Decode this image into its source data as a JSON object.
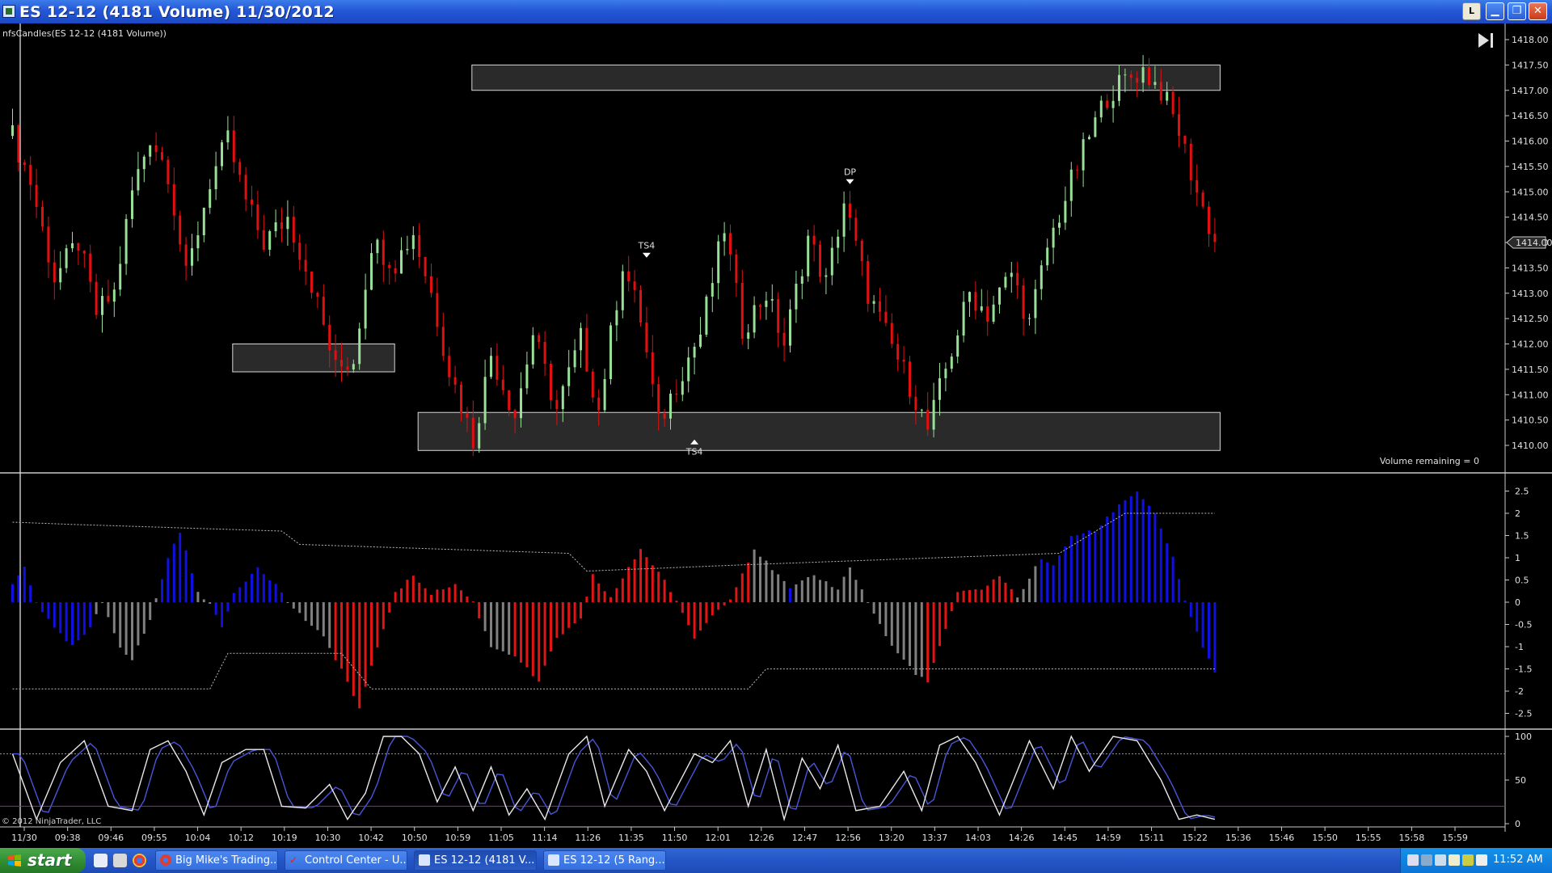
{
  "window": {
    "title": "ES 12-12 (4181 Volume)  11/30/2012",
    "btn_l": "L",
    "btn_min": "▁",
    "btn_max": "❐",
    "btn_close": "✕"
  },
  "chart_text": {
    "indicator_label": "nfsCandles(ES 12-12 (4181 Volume))",
    "volume_remaining": "Volume remaining = 0",
    "copyright": "© 2012 NinjaTrader, LLC",
    "price_marker": "1414.00",
    "markers": [
      "TS4",
      "DP",
      "TS4"
    ]
  },
  "colors": {
    "bull": "#98e098",
    "bear": "#e01010",
    "hist_blue": "#1010e0",
    "hist_red": "#e01515",
    "hist_gray": "#808080",
    "stoch_k": "#e8e8e8",
    "stoch_d": "#4a55d8",
    "axis_text": "#e0e0e0"
  },
  "chart_data": [
    {
      "type": "candlestick",
      "ylim": [
        1410.0,
        1418.0
      ],
      "y_ticks": [
        "1418.00",
        "1417.50",
        "1417.00",
        "1416.50",
        "1416.00",
        "1415.50",
        "1415.00",
        "1414.50",
        "1414.00",
        "1413.50",
        "1413.00",
        "1412.50",
        "1412.00",
        "1411.50",
        "1411.00",
        "1410.50",
        "1410.00"
      ],
      "x_ticks": [
        "11/30",
        "09:38",
        "09:46",
        "09:55",
        "10:04",
        "10:12",
        "10:19",
        "10:30",
        "10:42",
        "10:50",
        "10:59",
        "11:05",
        "11:14",
        "11:26",
        "11:35",
        "11:50",
        "12:01",
        "12:26",
        "12:47",
        "12:56",
        "13:20",
        "13:37",
        "14:03",
        "14:26",
        "14:45",
        "14:59",
        "15:11",
        "15:22",
        "15:36",
        "15:46",
        "15:50",
        "15:55",
        "15:58",
        "15:59"
      ],
      "close_path": [
        [
          0,
          1416.1
        ],
        [
          3,
          1415.2
        ],
        [
          7,
          1413.3
        ],
        [
          11,
          1414.0
        ],
        [
          14,
          1412.6
        ],
        [
          17,
          1413.0
        ],
        [
          20,
          1415.0
        ],
        [
          23,
          1416.1
        ],
        [
          26,
          1415.4
        ],
        [
          29,
          1413.3
        ],
        [
          33,
          1415.2
        ],
        [
          36,
          1416.0
        ],
        [
          39,
          1414.8
        ],
        [
          42,
          1414.0
        ],
        [
          46,
          1414.5
        ],
        [
          50,
          1413.2
        ],
        [
          54,
          1411.5
        ],
        [
          57,
          1411.7
        ],
        [
          60,
          1414.0
        ],
        [
          64,
          1413.6
        ],
        [
          67,
          1414.2
        ],
        [
          70,
          1413.0
        ],
        [
          73,
          1411.5
        ],
        [
          77,
          1410.1
        ],
        [
          80,
          1411.8
        ],
        [
          84,
          1410.6
        ],
        [
          87,
          1412.2
        ],
        [
          91,
          1410.7
        ],
        [
          95,
          1412.1
        ],
        [
          98,
          1410.7
        ],
        [
          102,
          1413.6
        ],
        [
          105,
          1412.5
        ],
        [
          108,
          1410.4
        ],
        [
          112,
          1411.5
        ],
        [
          115,
          1412.2
        ],
        [
          119,
          1414.3
        ],
        [
          122,
          1412.3
        ],
        [
          126,
          1413.0
        ],
        [
          129,
          1412.0
        ],
        [
          133,
          1414.1
        ],
        [
          136,
          1413.2
        ],
        [
          139,
          1414.8
        ],
        [
          143,
          1413.0
        ],
        [
          146,
          1412.2
        ],
        [
          150,
          1411.2
        ],
        [
          153,
          1410.3
        ],
        [
          156,
          1411.5
        ],
        [
          160,
          1413.0
        ],
        [
          163,
          1412.6
        ],
        [
          167,
          1413.4
        ],
        [
          170,
          1412.4
        ],
        [
          173,
          1413.9
        ],
        [
          177,
          1415.2
        ],
        [
          180,
          1416.1
        ],
        [
          183,
          1416.9
        ],
        [
          186,
          1417.2
        ],
        [
          189,
          1417.4
        ],
        [
          192,
          1417.0
        ],
        [
          195,
          1416.2
        ],
        [
          198,
          1415.0
        ],
        [
          201,
          1414.0
        ]
      ],
      "n_bars": 202,
      "zones": [
        {
          "x0": 77,
          "x1": 201,
          "y0": 1417.0,
          "y1": 1417.5
        },
        {
          "x0": 37,
          "x1": 63,
          "y0": 1411.45,
          "y1": 1412.0
        },
        {
          "x0": 68,
          "x1": 201,
          "y0": 1409.9,
          "y1": 1410.65
        }
      ],
      "marker_positions": [
        {
          "label": "TS4",
          "x": 106,
          "price": 1413.75,
          "dir": "down"
        },
        {
          "label": "DP",
          "x": 140,
          "price": 1415.2,
          "dir": "down"
        },
        {
          "label": "TS4",
          "x": 114,
          "price": 1410.1,
          "dir": "up"
        }
      ]
    },
    {
      "type": "histogram",
      "ylim": [
        -2.5,
        2.5
      ],
      "y_ticks": [
        "2.5",
        "2",
        "1.5",
        "1",
        "0.5",
        "0",
        "-0.5",
        "-1",
        "-1.5",
        "-2",
        "-2.5"
      ],
      "keypoints": [
        [
          0,
          0.4
        ],
        [
          2,
          0.8
        ],
        [
          4,
          0.0
        ],
        [
          7,
          -0.6
        ],
        [
          10,
          -1.0
        ],
        [
          13,
          -0.6
        ],
        [
          15,
          0.0
        ],
        [
          18,
          -1.0
        ],
        [
          20,
          -1.3
        ],
        [
          23,
          -0.4
        ],
        [
          26,
          1.0
        ],
        [
          28,
          1.6
        ],
        [
          31,
          0.2
        ],
        [
          33,
          0.0
        ],
        [
          35,
          -0.6
        ],
        [
          37,
          0.2
        ],
        [
          41,
          0.8
        ],
        [
          44,
          0.4
        ],
        [
          46,
          0.0
        ],
        [
          52,
          -0.8
        ],
        [
          55,
          -1.5
        ],
        [
          58,
          -2.4
        ],
        [
          61,
          -1.0
        ],
        [
          64,
          0.2
        ],
        [
          67,
          0.6
        ],
        [
          70,
          0.2
        ],
        [
          74,
          0.4
        ],
        [
          77,
          0.0
        ],
        [
          80,
          -1.0
        ],
        [
          84,
          -1.2
        ],
        [
          88,
          -1.8
        ],
        [
          91,
          -0.8
        ],
        [
          95,
          -0.4
        ],
        [
          97,
          0.6
        ],
        [
          100,
          0.1
        ],
        [
          105,
          1.2
        ],
        [
          109,
          0.5
        ],
        [
          111,
          0.0
        ],
        [
          114,
          -0.8
        ],
        [
          117,
          -0.3
        ],
        [
          120,
          0.1
        ],
        [
          124,
          1.2
        ],
        [
          126,
          0.9
        ],
        [
          130,
          0.3
        ],
        [
          134,
          0.6
        ],
        [
          138,
          0.3
        ],
        [
          140,
          0.8
        ],
        [
          143,
          0.0
        ],
        [
          147,
          -1.0
        ],
        [
          151,
          -1.6
        ],
        [
          153,
          -1.8
        ],
        [
          156,
          -0.6
        ],
        [
          158,
          0.2
        ],
        [
          162,
          0.3
        ],
        [
          165,
          0.6
        ],
        [
          168,
          0.1
        ],
        [
          172,
          1.0
        ],
        [
          174,
          0.8
        ],
        [
          177,
          1.5
        ],
        [
          181,
          1.6
        ],
        [
          185,
          2.2
        ],
        [
          188,
          2.5
        ],
        [
          191,
          2.0
        ],
        [
          194,
          1.0
        ],
        [
          196,
          0.0
        ],
        [
          199,
          -1.0
        ],
        [
          201,
          -1.6
        ]
      ],
      "colors_by_range": [
        [
          0,
          5,
          "blue"
        ],
        [
          5,
          14,
          "blue"
        ],
        [
          14,
          21,
          "gray"
        ],
        [
          21,
          25,
          "gray"
        ],
        [
          25,
          31,
          "blue"
        ],
        [
          31,
          34,
          "gray"
        ],
        [
          34,
          36,
          "blue"
        ],
        [
          36,
          46,
          "blue"
        ],
        [
          46,
          54,
          "gray"
        ],
        [
          54,
          68,
          "red"
        ],
        [
          68,
          79,
          "red"
        ],
        [
          79,
          84,
          "gray"
        ],
        [
          84,
          104,
          "red"
        ],
        [
          104,
          124,
          "red"
        ],
        [
          124,
          130,
          "gray"
        ],
        [
          130,
          131,
          "blue"
        ],
        [
          131,
          143,
          "gray"
        ],
        [
          143,
          153,
          "gray"
        ],
        [
          153,
          158,
          "red"
        ],
        [
          158,
          168,
          "red"
        ],
        [
          168,
          172,
          "gray"
        ],
        [
          172,
          174,
          "blue"
        ],
        [
          174,
          197,
          "blue"
        ],
        [
          197,
          202,
          "blue"
        ]
      ],
      "upper_band": [
        [
          0,
          1.8
        ],
        [
          10,
          1.75
        ],
        [
          45,
          1.6
        ],
        [
          48,
          1.3
        ],
        [
          93,
          1.1
        ],
        [
          96,
          0.7
        ],
        [
          124,
          0.85
        ],
        [
          175,
          1.1
        ],
        [
          186,
          2.0
        ],
        [
          201,
          2.0
        ]
      ],
      "lower_band": [
        [
          0,
          -1.95
        ],
        [
          33,
          -1.95
        ],
        [
          36,
          -1.15
        ],
        [
          55,
          -1.15
        ],
        [
          60,
          -1.95
        ],
        [
          123,
          -1.95
        ],
        [
          126,
          -1.5
        ],
        [
          201,
          -1.5
        ]
      ]
    },
    {
      "type": "line",
      "ylim": [
        0,
        100
      ],
      "y_ticks": [
        "100",
        "50",
        "0"
      ],
      "levels": [
        80,
        20
      ],
      "k_keypoints": [
        [
          0,
          80
        ],
        [
          4,
          5
        ],
        [
          8,
          70
        ],
        [
          12,
          95
        ],
        [
          16,
          20
        ],
        [
          20,
          15
        ],
        [
          23,
          85
        ],
        [
          26,
          95
        ],
        [
          29,
          60
        ],
        [
          32,
          10
        ],
        [
          35,
          70
        ],
        [
          39,
          85
        ],
        [
          42,
          85
        ],
        [
          45,
          20
        ],
        [
          49,
          18
        ],
        [
          53,
          45
        ],
        [
          56,
          5
        ],
        [
          59,
          35
        ],
        [
          62,
          100
        ],
        [
          65,
          100
        ],
        [
          68,
          80
        ],
        [
          71,
          25
        ],
        [
          74,
          65
        ],
        [
          77,
          15
        ],
        [
          80,
          65
        ],
        [
          83,
          10
        ],
        [
          86,
          40
        ],
        [
          89,
          5
        ],
        [
          93,
          80
        ],
        [
          96,
          100
        ],
        [
          99,
          20
        ],
        [
          103,
          85
        ],
        [
          106,
          60
        ],
        [
          109,
          15
        ],
        [
          114,
          80
        ],
        [
          117,
          70
        ],
        [
          120,
          95
        ],
        [
          123,
          20
        ],
        [
          126,
          85
        ],
        [
          129,
          5
        ],
        [
          132,
          75
        ],
        [
          135,
          40
        ],
        [
          138,
          90
        ],
        [
          141,
          15
        ],
        [
          145,
          20
        ],
        [
          149,
          60
        ],
        [
          152,
          15
        ],
        [
          155,
          90
        ],
        [
          158,
          100
        ],
        [
          161,
          70
        ],
        [
          165,
          10
        ],
        [
          170,
          95
        ],
        [
          174,
          40
        ],
        [
          177,
          100
        ],
        [
          180,
          60
        ],
        [
          184,
          100
        ],
        [
          188,
          95
        ],
        [
          192,
          50
        ],
        [
          195,
          5
        ],
        [
          198,
          10
        ],
        [
          201,
          5
        ]
      ],
      "d_lag": 1.5
    }
  ]
}
